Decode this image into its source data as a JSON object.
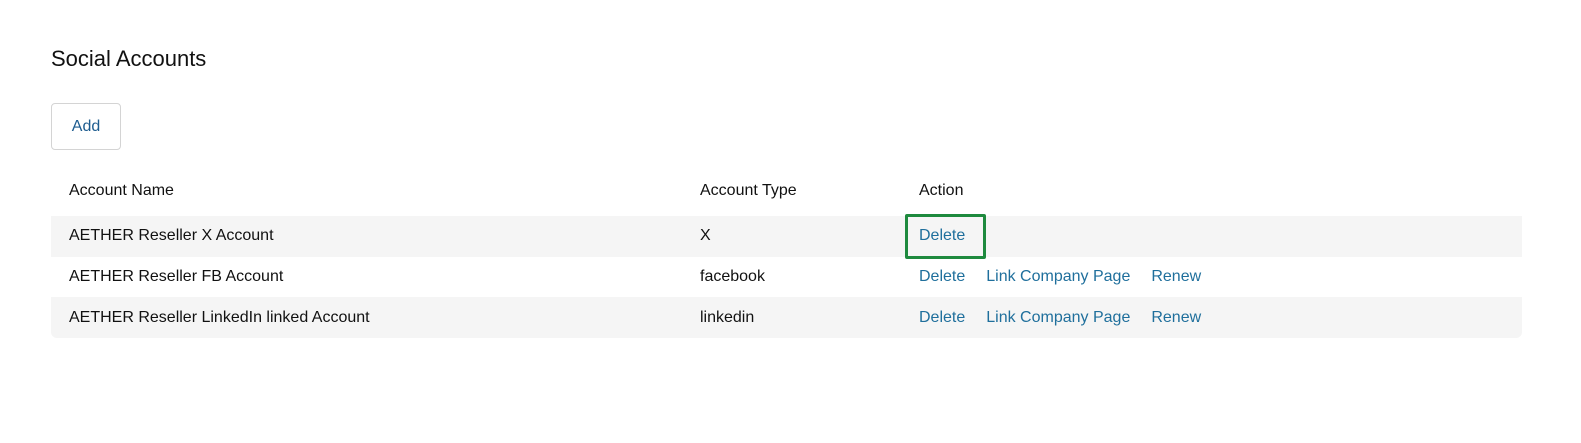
{
  "page": {
    "title": "Social Accounts"
  },
  "toolbar": {
    "add_label": "Add"
  },
  "table": {
    "columns": [
      "Account Name",
      "Account Type",
      "Action"
    ],
    "rows": [
      {
        "name": "AETHER Reseller X Account",
        "type": "X",
        "actions": [
          "Delete"
        ]
      },
      {
        "name": "AETHER Reseller FB Account",
        "type": "facebook",
        "actions": [
          "Delete",
          "Link Company Page",
          "Renew"
        ]
      },
      {
        "name": "AETHER Reseller LinkedIn linked Account",
        "type": "linkedin",
        "actions": [
          "Delete",
          "Link Company Page",
          "Renew"
        ]
      }
    ]
  },
  "colors": {
    "link": "#1f6f9c",
    "highlight_border": "#1e8a3e",
    "row_shade": "#f5f5f5"
  }
}
